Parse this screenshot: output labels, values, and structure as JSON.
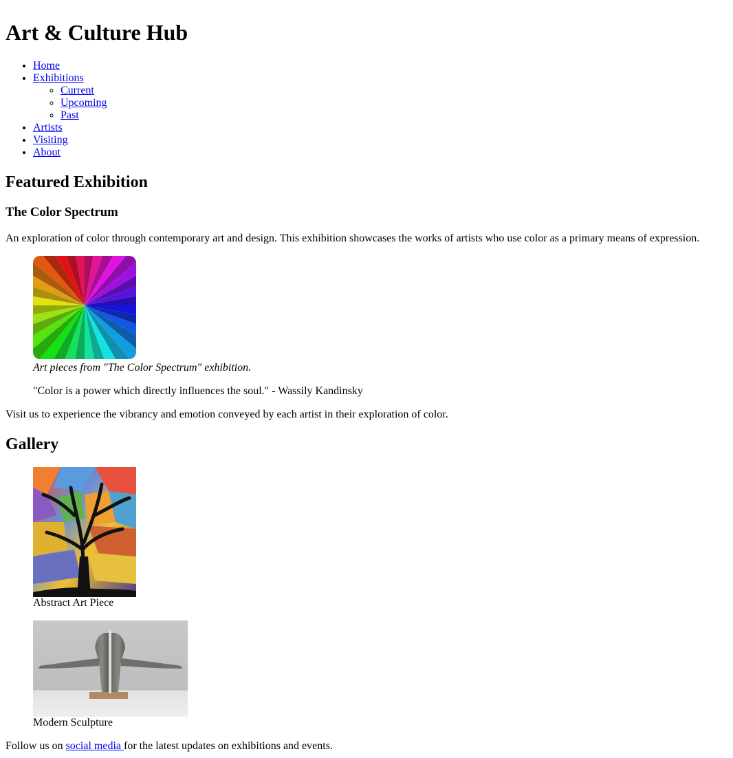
{
  "site": {
    "title": "Art & Culture Hub"
  },
  "nav": {
    "items": [
      {
        "label": "Home"
      },
      {
        "label": "Exhibitions",
        "children": [
          {
            "label": "Current"
          },
          {
            "label": "Upcoming"
          },
          {
            "label": "Past"
          }
        ]
      },
      {
        "label": "Artists"
      },
      {
        "label": "Visiting"
      },
      {
        "label": "About"
      }
    ]
  },
  "featured": {
    "heading": "Featured Exhibition",
    "title": "The Color Spectrum",
    "description": "An exploration of color through contemporary art and design. This exhibition showcases the works of artists who use color as a primary means of expression.",
    "figure_caption": "Art pieces from \"The Color Spectrum\" exhibition.",
    "quote": "\"Color is a power which directly influences the soul.\" - Wassily Kandinsky",
    "visit_text": "Visit us to experience the vibrancy and emotion conveyed by each artist in their exploration of color."
  },
  "gallery": {
    "heading": "Gallery",
    "items": [
      {
        "caption": "Abstract Art Piece"
      },
      {
        "caption": "Modern Sculpture"
      }
    ]
  },
  "footer": {
    "prefix": "Follow us on ",
    "link": "social media ",
    "suffix": "for the latest updates on exhibitions and events."
  }
}
